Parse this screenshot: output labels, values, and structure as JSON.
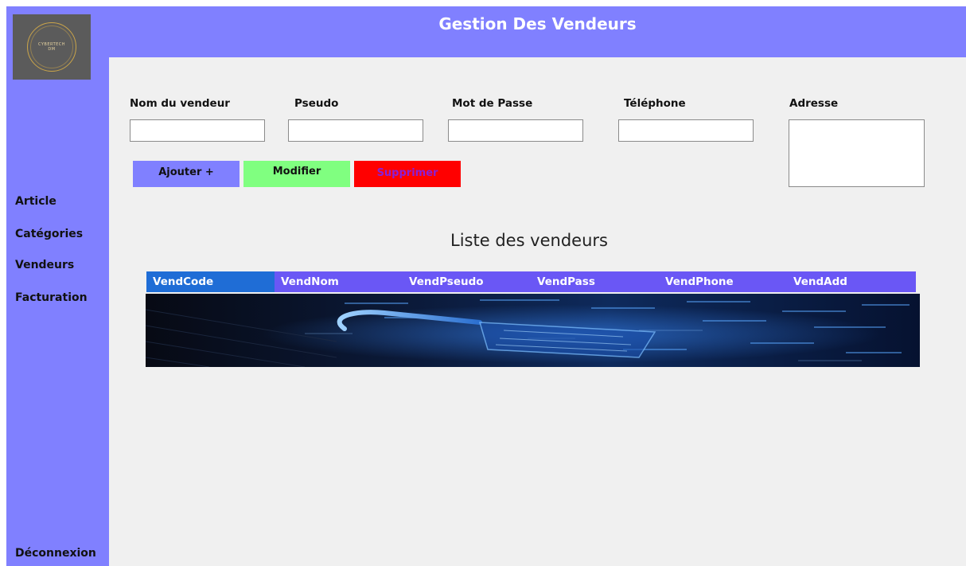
{
  "logo": {
    "text_line1": "CYBERTECH",
    "text_line2": "DM"
  },
  "header": {
    "title": "Gestion Des Vendeurs"
  },
  "sidebar": {
    "items": [
      {
        "label": "Article"
      },
      {
        "label": "Catégories"
      },
      {
        "label": "Vendeurs"
      },
      {
        "label": "Facturation"
      }
    ],
    "logout_label": "Déconnexion"
  },
  "form": {
    "nom_label": "Nom du vendeur",
    "pseudo_label": "Pseudo",
    "password_label": "Mot de Passe",
    "phone_label": "Téléphone",
    "address_label": "Adresse",
    "nom_value": "",
    "pseudo_value": "",
    "password_value": "",
    "phone_value": "",
    "address_value": ""
  },
  "buttons": {
    "add_label": "Ajouter +",
    "edit_label": "Modifier",
    "delete_label": "Supprimer"
  },
  "list": {
    "title": "Liste des vendeurs",
    "columns": [
      "VendCode",
      "VendNom",
      "VendPseudo",
      "VendPass",
      "VendPhone",
      "VendAdd"
    ],
    "selected_column": "VendCode"
  },
  "colors": {
    "accent": "#8080ff",
    "header_bg": "#8080ff",
    "add_button": "#8080ff",
    "edit_button": "#80ff80",
    "delete_button": "#ff0000",
    "grid_header": "#6a57f5",
    "grid_selected": "#1f6dd6"
  }
}
